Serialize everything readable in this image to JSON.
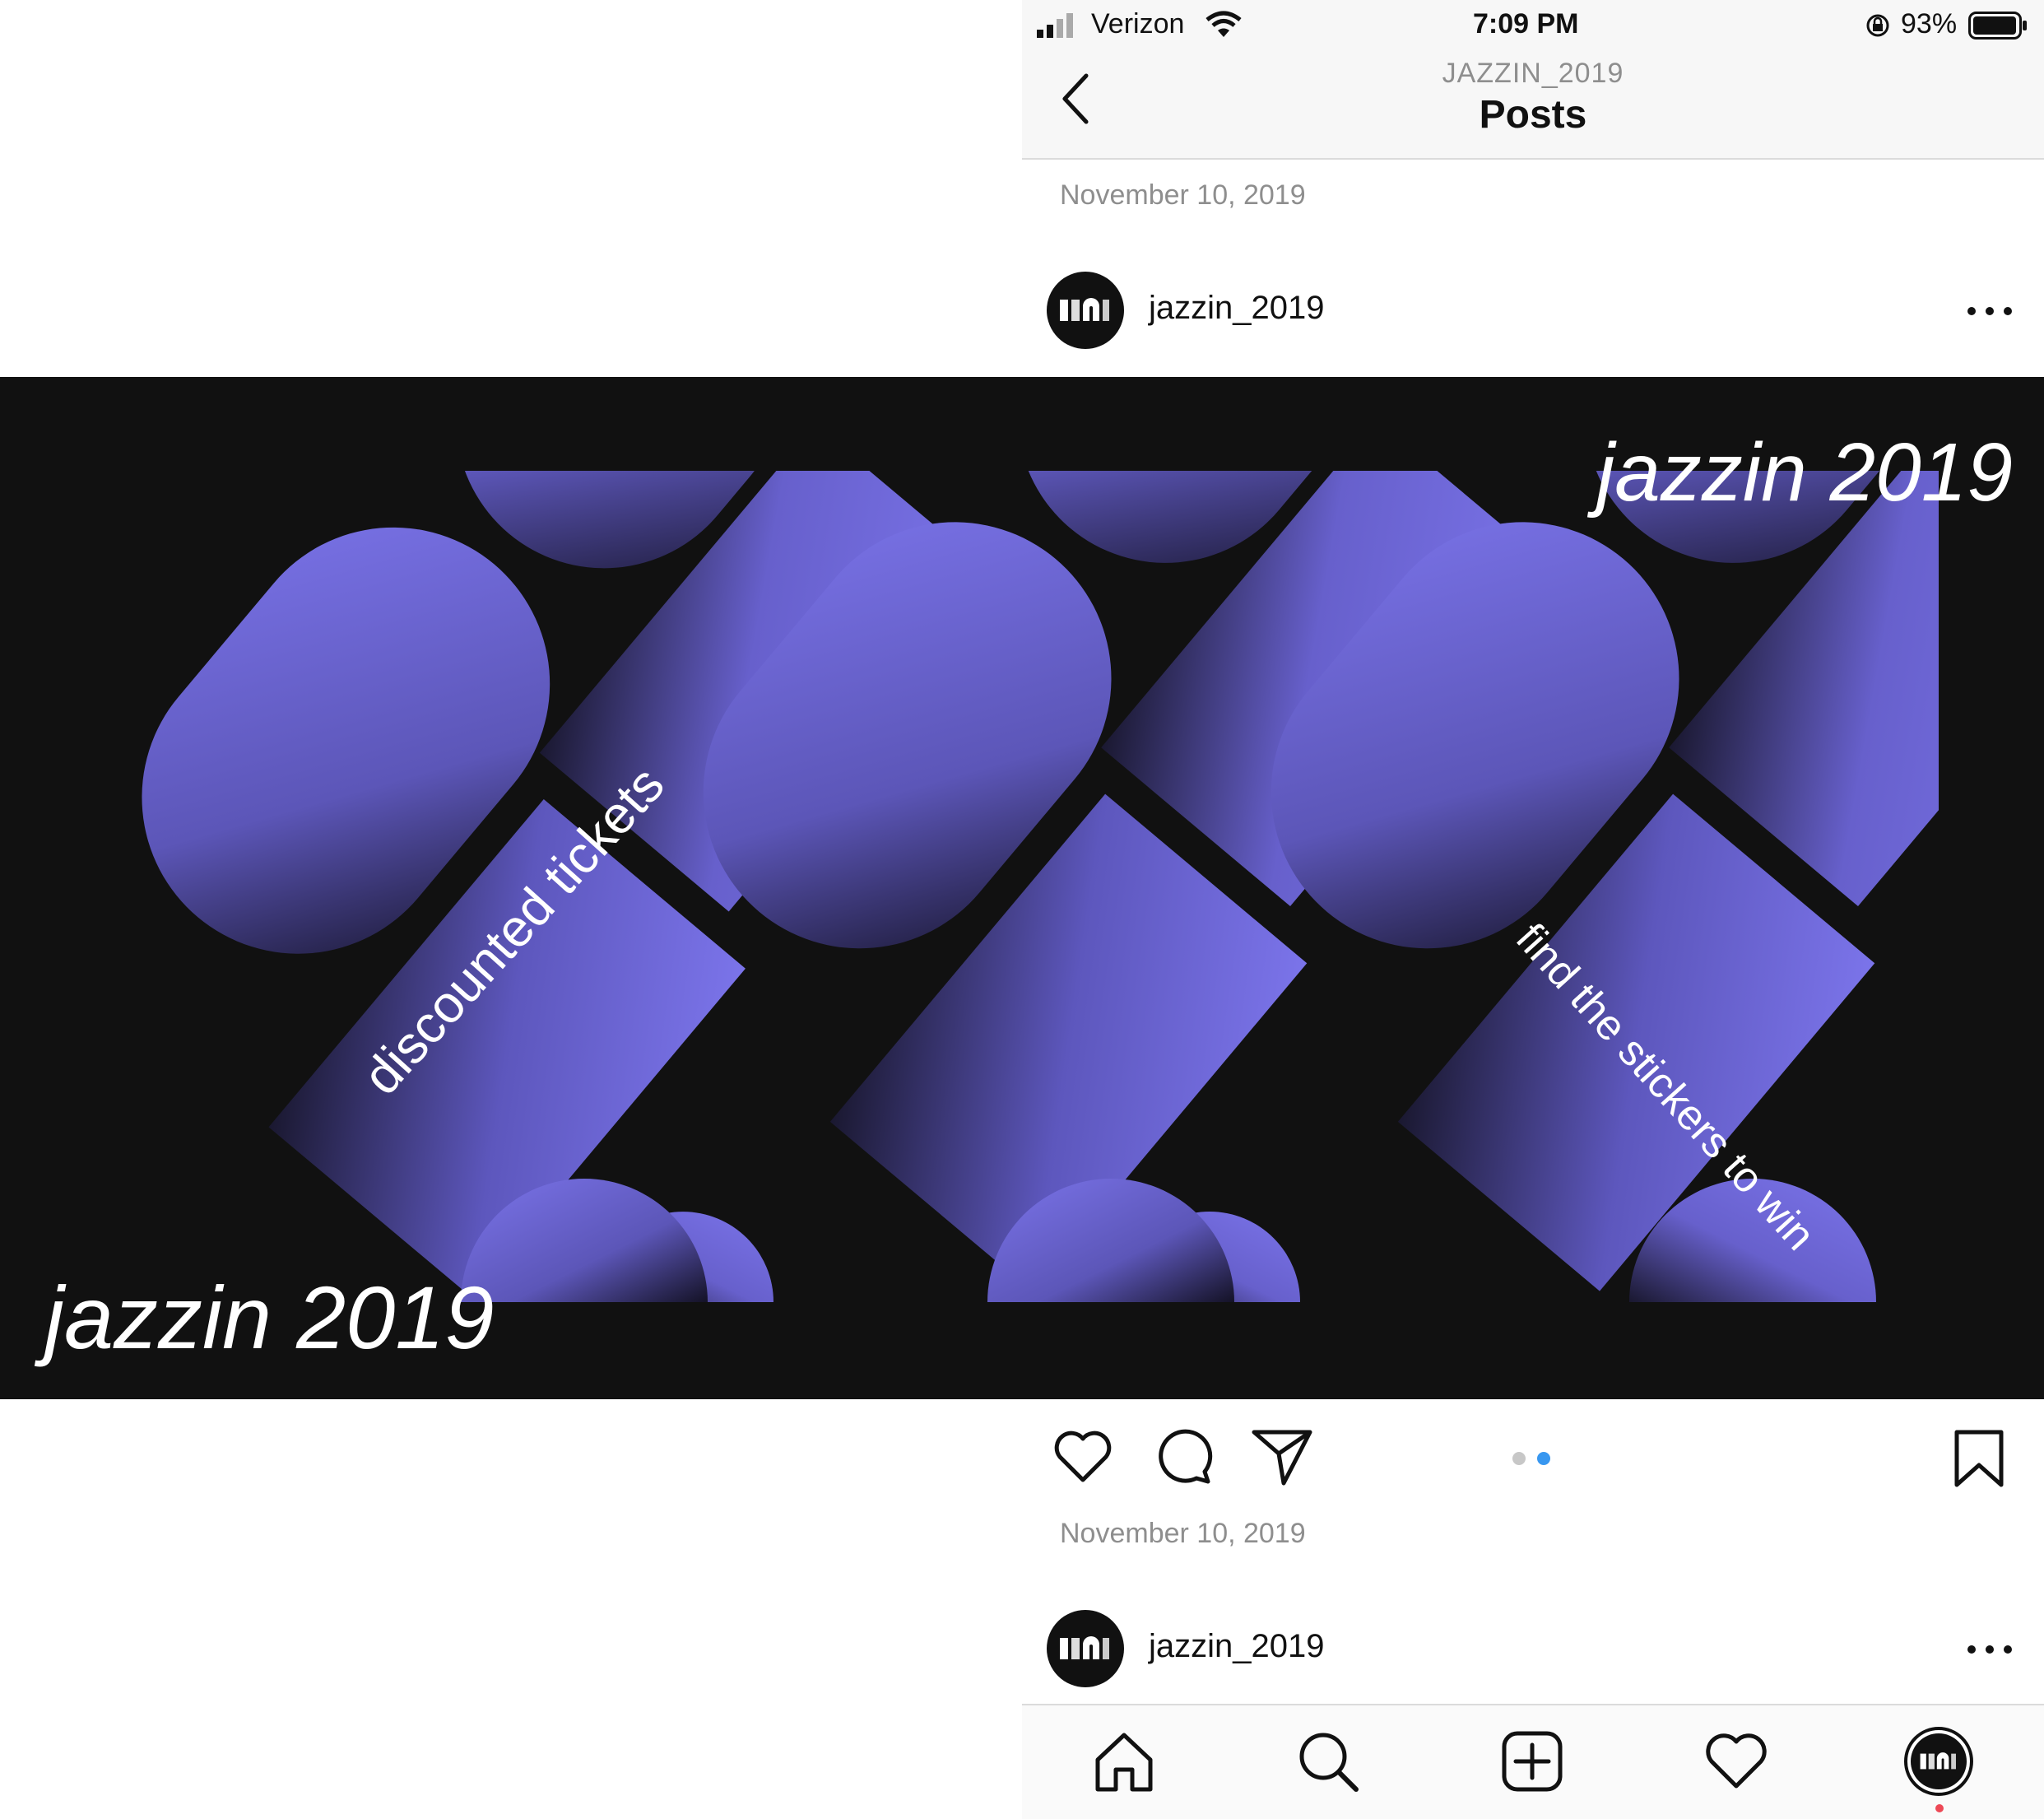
{
  "status_bar": {
    "carrier": "Verizon",
    "time": "7:09 PM",
    "battery": "93%",
    "icons": [
      "signal-icon",
      "wifi-icon",
      "orientation-lock-icon",
      "battery-icon"
    ]
  },
  "header": {
    "account": "JAZZIN_2019",
    "title": "Posts",
    "back_icon": "chevron-left-icon"
  },
  "posts": [
    {
      "date": "November 10, 2019",
      "username": "jazzin_2019",
      "image_text": {
        "title_top": "jazzin 2019",
        "title_bottom": "jazzin 2019",
        "diagonal_left": "discounted tickets",
        "diagonal_right": "find the stickers to win"
      },
      "carousel": {
        "count": 2,
        "active": 2
      },
      "actions": [
        "heart-icon",
        "comment-icon",
        "share-icon",
        "bookmark-icon"
      ],
      "footer_date": "November 10, 2019"
    },
    {
      "username": "jazzin_2019"
    }
  ],
  "tab_bar": [
    "home-icon",
    "search-icon",
    "add-post-icon",
    "activity-icon",
    "profile-avatar"
  ],
  "colors": {
    "accent": "#7b74ea",
    "dark": "#111111",
    "active_dot": "#3897f0",
    "inactive_dot": "#c7c7c7",
    "notification_dot": "#ed4956"
  }
}
